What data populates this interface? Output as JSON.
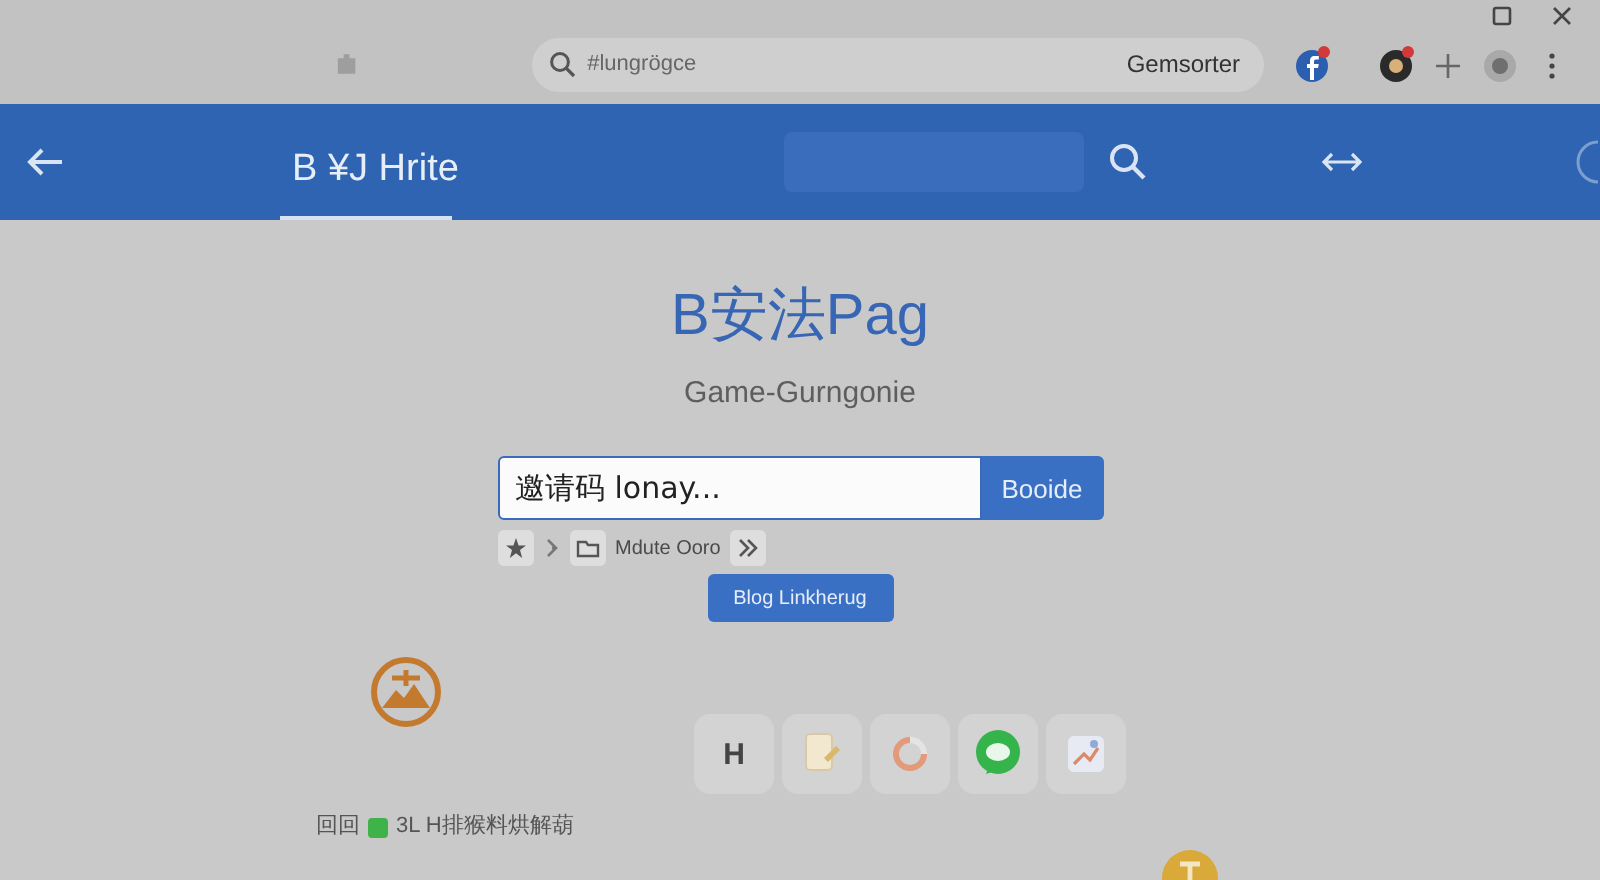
{
  "browser": {
    "address_bar": {
      "value": "#lungrögce"
    },
    "profile_label": "Gemsorter",
    "toolbar_icons": [
      {
        "kind": "facebook",
        "badge": true
      },
      {
        "kind": "avatar",
        "badge": true
      },
      {
        "kind": "plus",
        "badge": false
      },
      {
        "kind": "profile",
        "badge": false
      },
      {
        "kind": "menu",
        "badge": false
      }
    ]
  },
  "header": {
    "tabs": [
      {
        "label": "B ¥J Hrite",
        "selected": true
      }
    ]
  },
  "hero": {
    "title": "B安法Pag",
    "subtitle": "Game-Gurngonie",
    "invite_field": {
      "value": "邀请码 lonay..."
    },
    "submit_button": "Booide",
    "tools": [
      {
        "kind": "star"
      },
      {
        "kind": "small-glyph"
      },
      {
        "kind": "folder"
      },
      {
        "kind": "text",
        "label": "Mdute Ooro"
      },
      {
        "kind": "chevrons"
      }
    ],
    "link_button": "Blog Linkherug"
  },
  "dock": [
    {
      "kind": "text",
      "label": "H"
    },
    {
      "kind": "document"
    },
    {
      "kind": "ring"
    },
    {
      "kind": "chat"
    },
    {
      "kind": "map"
    }
  ],
  "footer": {
    "prefix": "回回",
    "text": "3L H排猴料烘解葫"
  }
}
